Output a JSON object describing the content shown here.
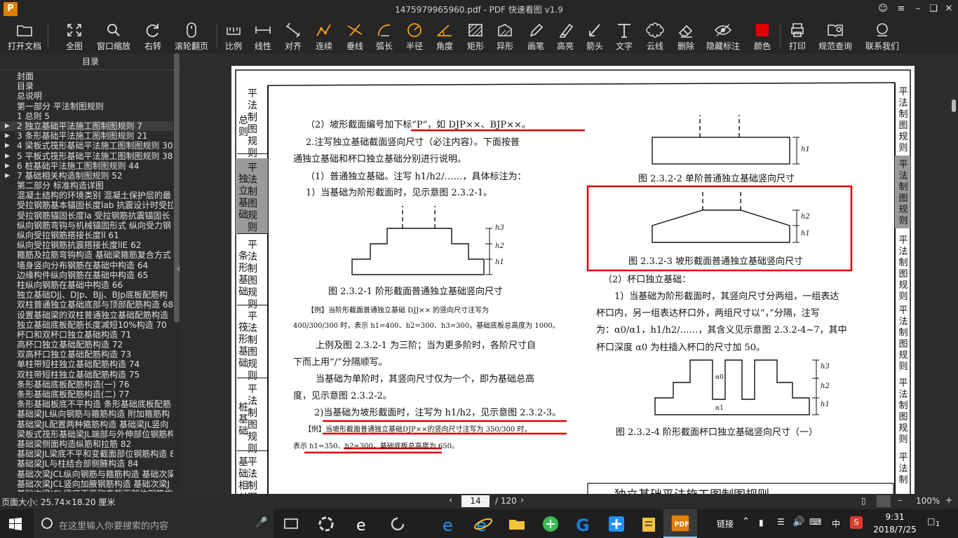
{
  "window": {
    "logo": "P",
    "title": "1475979965960.pdf - PDF 快速看图 v1.9"
  },
  "toolbar": {
    "items": [
      {
        "label": "打开文档"
      },
      {
        "label": "全图"
      },
      {
        "label": "窗口缩放"
      },
      {
        "label": "右转"
      },
      {
        "label": "滚轮翻页"
      },
      {
        "label": "比例"
      },
      {
        "label": "线性"
      },
      {
        "label": "对齐"
      },
      {
        "label": "连续"
      },
      {
        "label": "垂线"
      },
      {
        "label": "弧长"
      },
      {
        "label": "半径"
      },
      {
        "label": "角度"
      },
      {
        "label": "矩形"
      },
      {
        "label": "异形"
      },
      {
        "label": "画笔"
      },
      {
        "label": "高亮"
      },
      {
        "label": "箭头"
      },
      {
        "label": "文字"
      },
      {
        "label": "云线"
      },
      {
        "label": "删除"
      },
      {
        "label": "隐藏标注"
      },
      {
        "label": "颜色"
      },
      {
        "label": "打印"
      },
      {
        "label": "规范查询"
      },
      {
        "label": "联系我们"
      }
    ],
    "accent": "#f0a020",
    "color_swatch": "#e00000"
  },
  "sidebar": {
    "title": "目录",
    "items": [
      {
        "label": "封面"
      },
      {
        "label": "目录"
      },
      {
        "label": "总说明"
      },
      {
        "label": "第一部分  平法制图规则"
      },
      {
        "label": "1  总则 5"
      },
      {
        "label": "2  独立基础平法施工图制图规则 7",
        "arrow": "▶"
      },
      {
        "label": "3  条形基础平法施工图制图规则 21",
        "arrow": "▶"
      },
      {
        "label": "4  梁板式筏形基础平法施工图制图规则 30",
        "arrow": "▶"
      },
      {
        "label": "5  平板式筏形基础平法施工图制图规则 38",
        "arrow": "▶"
      },
      {
        "label": "6  桩基础平法施工图制图规则 44",
        "arrow": "▶"
      },
      {
        "label": "7  基础相关构造制图规则 52",
        "arrow": "▶"
      },
      {
        "label": "第二部分  标准构造详图"
      },
      {
        "label": "混凝土结构的环境类别  混凝土保护层的最"
      },
      {
        "label": "受拉钢筋基本锚固长度lab  抗震设计时受拉"
      },
      {
        "label": "受拉钢筋锚固长度la  受拉钢筋抗震锚固长"
      },
      {
        "label": "纵向钢筋弯钩与机械锚固形式  纵向受力钢"
      },
      {
        "label": "纵向受拉钢筋搭接长度ll  61"
      },
      {
        "label": "纵向受拉钢筋抗震搭接长度llE  62"
      },
      {
        "label": "箍筋及拉筋弯钩构造  基础梁箍筋复合方式"
      },
      {
        "label": "墙身竖向分布钢筋在基础中构造  64"
      },
      {
        "label": "边缘构件纵向钢筋在基础中构造  65"
      },
      {
        "label": "柱纵向钢筋在基础中构造  66"
      },
      {
        "label": "独立基础DJj、DJp、BJj、BJp底板配筋构"
      },
      {
        "label": "双柱普通独立基础底部与顶部配筋构造  68"
      },
      {
        "label": "设置基础梁的双柱普通独立基础配筋构造"
      },
      {
        "label": "独立基础底板配筋长度减短10%构造  70"
      },
      {
        "label": "杯口和双杯口独立基础构造  71"
      },
      {
        "label": "高杯口独立基础配筋构造  72"
      },
      {
        "label": "双高杯口独立基础配筋构造  73"
      },
      {
        "label": "单柱带短柱独立基础配筋构造  74"
      },
      {
        "label": "双柱带短柱独立基础配筋构造  75"
      },
      {
        "label": "条形基础底板配筋构造(一)  76"
      },
      {
        "label": "条形基础底板配筋构造(二)  77"
      },
      {
        "label": "条形基础板底不平构造  条形基础底板配筋"
      },
      {
        "label": "基础梁JL纵向钢筋与箍筋构造  附加箍筋构"
      },
      {
        "label": "基础梁JL配置两种箍筋构造  基础梁JL竖向"
      },
      {
        "label": "梁板式筏形基础梁JL端部与外伸部位钢筋构"
      },
      {
        "label": "基础梁侧面构造纵筋和拉筋  82"
      },
      {
        "label": "基础梁JL梁底不平和变截面部位钢筋构造  8"
      },
      {
        "label": "基础梁JL与柱结合部侧腋构造  84"
      },
      {
        "label": "基础次梁JCL纵向钢筋与箍筋构造  基础次梁"
      },
      {
        "label": "基础次梁JCL竖向加腋钢筋构造  基础次梁J"
      },
      {
        "label": "基础次梁JCL梁底不平和变截面部位钢筋构"
      }
    ]
  },
  "document": {
    "left_tabs": [
      {
        "label": "总则"
      },
      {
        "label": "平法制图规则"
      },
      {
        "label": "独立基础"
      },
      {
        "label": "平法制图规则"
      },
      {
        "label": "条形基础"
      },
      {
        "label": "平法制图规则"
      },
      {
        "label": "筏形基础"
      },
      {
        "label": "平法制图规则"
      },
      {
        "label": "桩基础"
      },
      {
        "label": "平法制图规则"
      },
      {
        "label": "基础相关"
      },
      {
        "label": "平法制图"
      }
    ],
    "right_tabs": [
      {
        "label": "平法制图规则"
      },
      {
        "label": "平法制图规则"
      },
      {
        "label": "平法制图规则"
      },
      {
        "label": "平法制图规则"
      },
      {
        "label": "平法制图规则"
      },
      {
        "label": "平法制"
      }
    ],
    "left_col": {
      "l1": "（2）坡形截面编号加下标“P”，如 DJP××、BJP××。",
      "l2": "2.注写独立基础截面竖向尺寸（必注内容）。下面按普",
      "l3": "通独立基础和杯口独立基础分别进行说明。",
      "l4": "（1）普通独立基础。注写 h1/h2/……，具体标注为：",
      "l5": "1）当基础为阶形截面时，见示意图 2.3.2-1。",
      "fig1_caption": "图 2.3.2-1  阶形截面普通独立基础竖向尺寸",
      "ex1": "【例】当阶形截面普通独立基础 DJJ×× 的竖向尺寸注写为",
      "ex2": "400/300/300 时，表示 h1=400、h2=300、h3=300，基础底板总高度为 1000。",
      "l6": "上例及图 2.3.2-1 为三阶；当为更多阶时，各阶尺寸自",
      "l7": "下而上用“/”分隔顺写。",
      "l8": "当基础为单阶时，其竖向尺寸仅为一个，即为基础总高",
      "l9": "度，见示意图 2.3.2-2。",
      "l10": "2)当基础为坡形截面时，注写为 h1/h2，见示意图 2.3.2-3。",
      "ex3": "【例】当坡形截面普通独立基础DJP××的竖向尺寸注写为 350/300 时，",
      "ex4": "表示 h1=350、h2=300，基础底板总高度为 650。",
      "h1": "h1",
      "h2": "h2",
      "h3": "h3"
    },
    "right_col": {
      "fig2_caption": "图 2.3.2-2  单阶普通独立基础竖向尺寸",
      "fig3_caption": "图 2.3.2-3  坡形截面普通独立基础竖向尺寸",
      "r1": "（2）杯口独立基础：",
      "r2": "1）当基础为阶形截面时，其竖向尺寸分两组，一组表达",
      "r3": "杯口内，另一组表达杯口外，两组尺寸以“，”分隔，注写",
      "r4": "为：α0/α1，h1/h2/……，其含义见示意图 2.3.2-4~7，其中",
      "r5": "杯口深度 α0 为柱插入杯口的尺寸加 50。",
      "fig4_caption": "图 2.3.2-4  阶形截面杯口独立基础竖向尺寸（一）",
      "bottom_title": "独立基础平法施工图制图规则",
      "a0": "α0",
      "a1": "α1"
    },
    "annotation_color": "#e00000"
  },
  "statusbar": {
    "page_size": "页面大小: 25.74×18.20 厘米",
    "current_page": "14",
    "total_pages": "/ 120",
    "zoom": "100%"
  },
  "taskbar": {
    "search_placeholder": "在这里输入你要搜索的内容",
    "link_label": "链接",
    "ime": "中",
    "time": "9:31",
    "date": "2018/7/25",
    "notifications": "1"
  }
}
